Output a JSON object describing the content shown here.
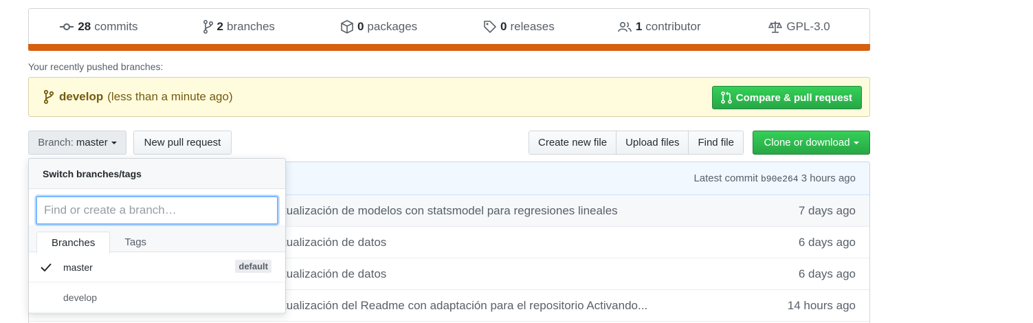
{
  "stats": [
    {
      "icon": "commit-icon",
      "num": "28",
      "label": "commits"
    },
    {
      "icon": "branch-icon",
      "num": "2",
      "label": "branches"
    },
    {
      "icon": "package-icon",
      "num": "0",
      "label": "packages"
    },
    {
      "icon": "tag-icon",
      "num": "0",
      "label": "releases"
    },
    {
      "icon": "people-icon",
      "num": "1",
      "label": "contributor"
    },
    {
      "icon": "law-icon",
      "num": "",
      "label": "GPL-3.0"
    }
  ],
  "language_bar_color": "#d75f0e",
  "recent_label": "Your recently pushed branches:",
  "push": {
    "branch": "develop",
    "when": "(less than a minute ago)",
    "compare_label": "Compare & pull request"
  },
  "toolbar": {
    "branch_prefix": "Branch:",
    "branch_name": "master",
    "new_pr": "New pull request",
    "create_file": "Create new file",
    "upload_files": "Upload files",
    "find_file": "Find file",
    "clone": "Clone or download"
  },
  "latest_commit": {
    "label": "Latest commit",
    "sha": "b90e264",
    "age": "3 hours ago"
  },
  "files": [
    {
      "message": "tualización de modelos con statsmodel para regresiones lineales",
      "age": "7 days ago"
    },
    {
      "message": "tualización de datos",
      "age": "6 days ago"
    },
    {
      "message": "tualización de datos",
      "age": "6 days ago"
    },
    {
      "message": "tualización del Readme con adaptación para el repositorio Activando...",
      "age": "14 hours ago"
    }
  ],
  "dropdown": {
    "title": "Switch branches/tags",
    "placeholder": "Find or create a branch…",
    "tabs": [
      "Branches",
      "Tags"
    ],
    "branches": [
      {
        "name": "master",
        "badge": "default",
        "selected": true
      },
      {
        "name": "develop",
        "badge": "",
        "selected": false
      }
    ]
  },
  "colors": {
    "accent_green": "#28a745",
    "push_bg": "#fffbdd",
    "input_focus": "#79b8ff"
  }
}
